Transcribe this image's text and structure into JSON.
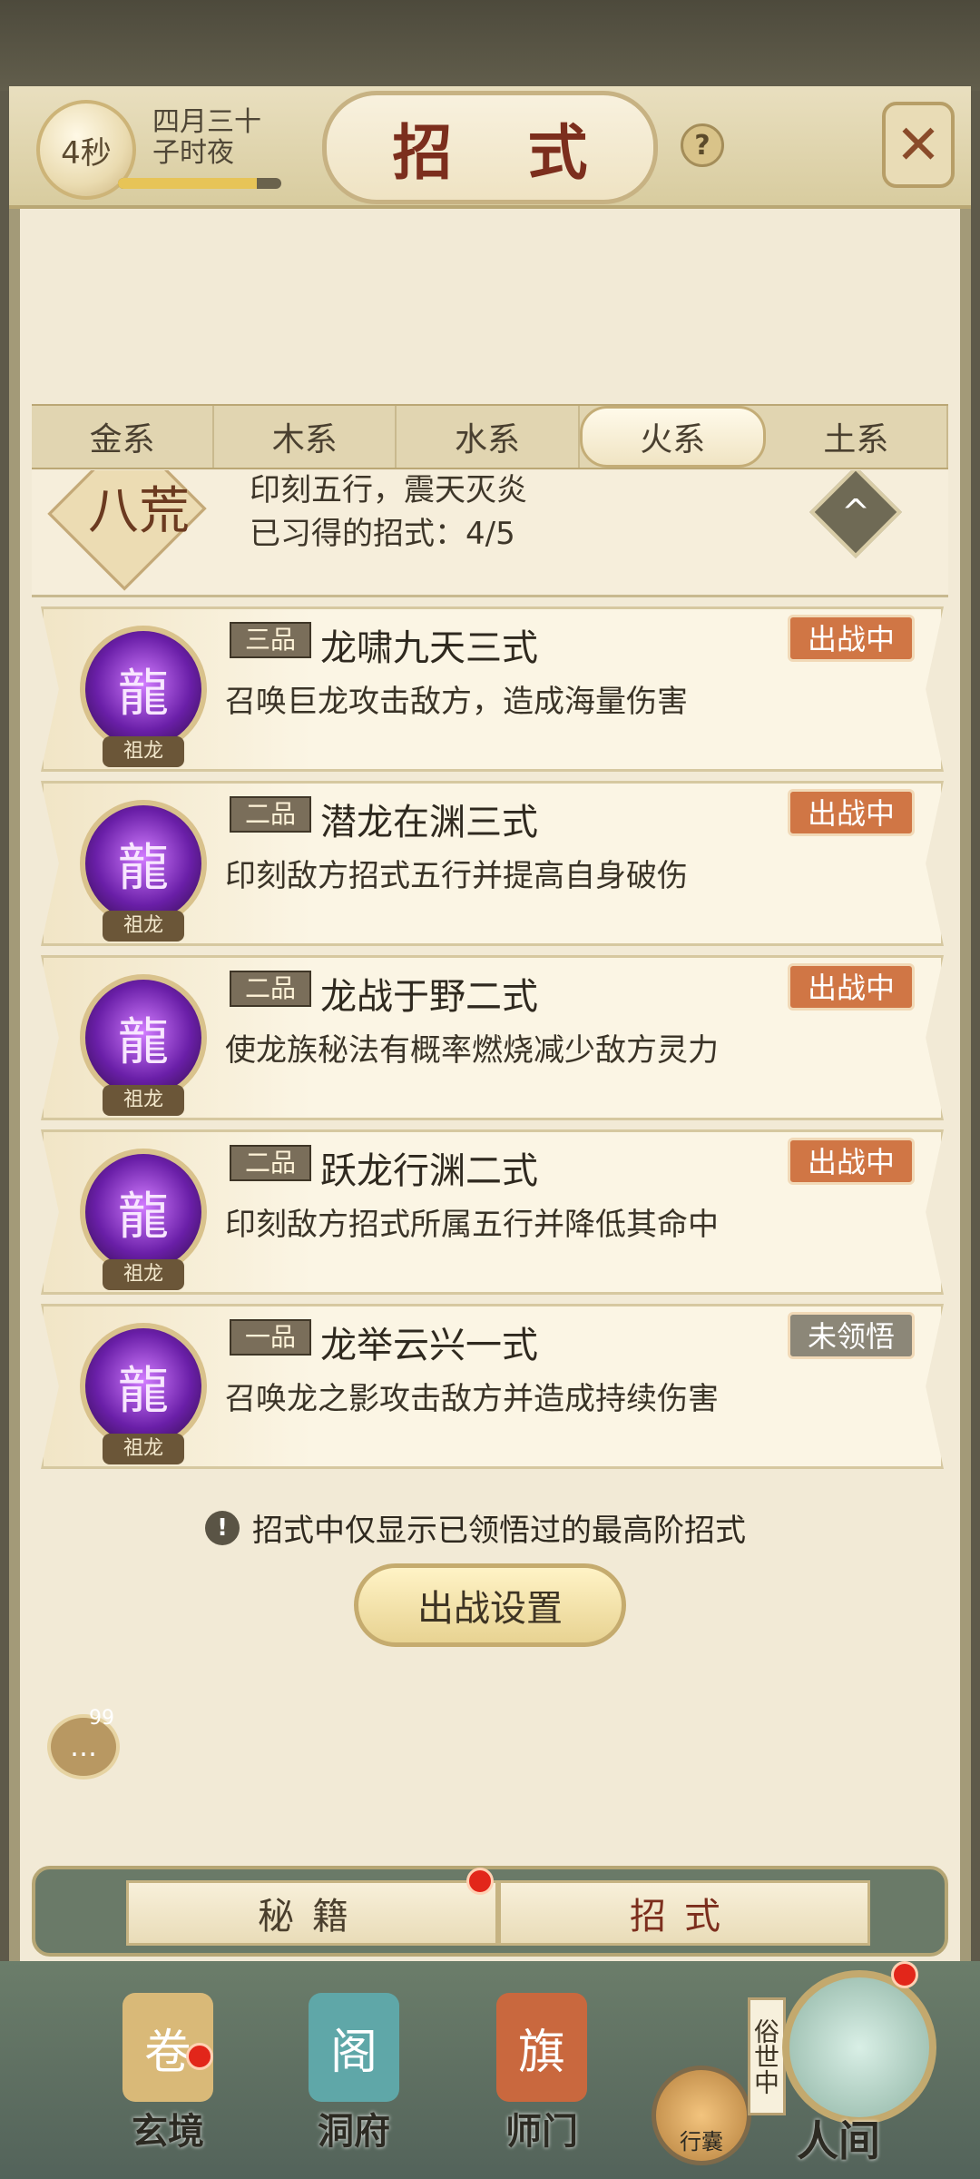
{
  "header": {
    "timer": "4秒",
    "date_line1": "四月三十",
    "date_line2": "子时夜",
    "title": "招 式",
    "help": "?",
    "close": "✕"
  },
  "element_tabs": [
    "金系",
    "木系",
    "水系",
    "火系",
    "土系"
  ],
  "active_tab_index": 3,
  "summary": {
    "seal_text": "八荒",
    "line1": "印刻五行，震天灭炎",
    "line2": "已习得的招式：4/5",
    "up_icon": "up-arrow-icon"
  },
  "skills": [
    {
      "grade": "三品",
      "name": "龙啸九天三式",
      "desc": "召唤巨龙攻击敌方，造成海量伤害",
      "status": "出战中",
      "status_active": true,
      "tag": "祖龙"
    },
    {
      "grade": "二品",
      "name": "潜龙在渊三式",
      "desc": "印刻敌方招式五行并提高自身破伤",
      "status": "出战中",
      "status_active": true,
      "tag": "祖龙"
    },
    {
      "grade": "二品",
      "name": "龙战于野二式",
      "desc": "使龙族秘法有概率燃烧减少敌方灵力",
      "status": "出战中",
      "status_active": true,
      "tag": "祖龙"
    },
    {
      "grade": "二品",
      "name": "跃龙行渊二式",
      "desc": "印刻敌方招式所属五行并降低其命中",
      "status": "出战中",
      "status_active": true,
      "tag": "祖龙"
    },
    {
      "grade": "一品",
      "name": "龙举云兴一式",
      "desc": "召唤龙之影攻击敌方并造成持续伤害",
      "status": "未领悟",
      "status_active": false,
      "tag": "祖龙"
    }
  ],
  "notice": "招式中仅显示已领悟过的最高阶招式",
  "battle_button": "出战设置",
  "chat": {
    "badge": "99"
  },
  "switch": {
    "left": "秘籍",
    "right": "招式"
  },
  "bottom_nav": {
    "items": [
      "玄境",
      "洞府",
      "师门"
    ],
    "bag": "行囊",
    "world_tag": "俗世中",
    "world": "人间"
  },
  "colors": {
    "status_on": "#d07645",
    "status_off": "#8c8778",
    "title": "#7c2e1d",
    "red_dot": "#e2261a"
  }
}
